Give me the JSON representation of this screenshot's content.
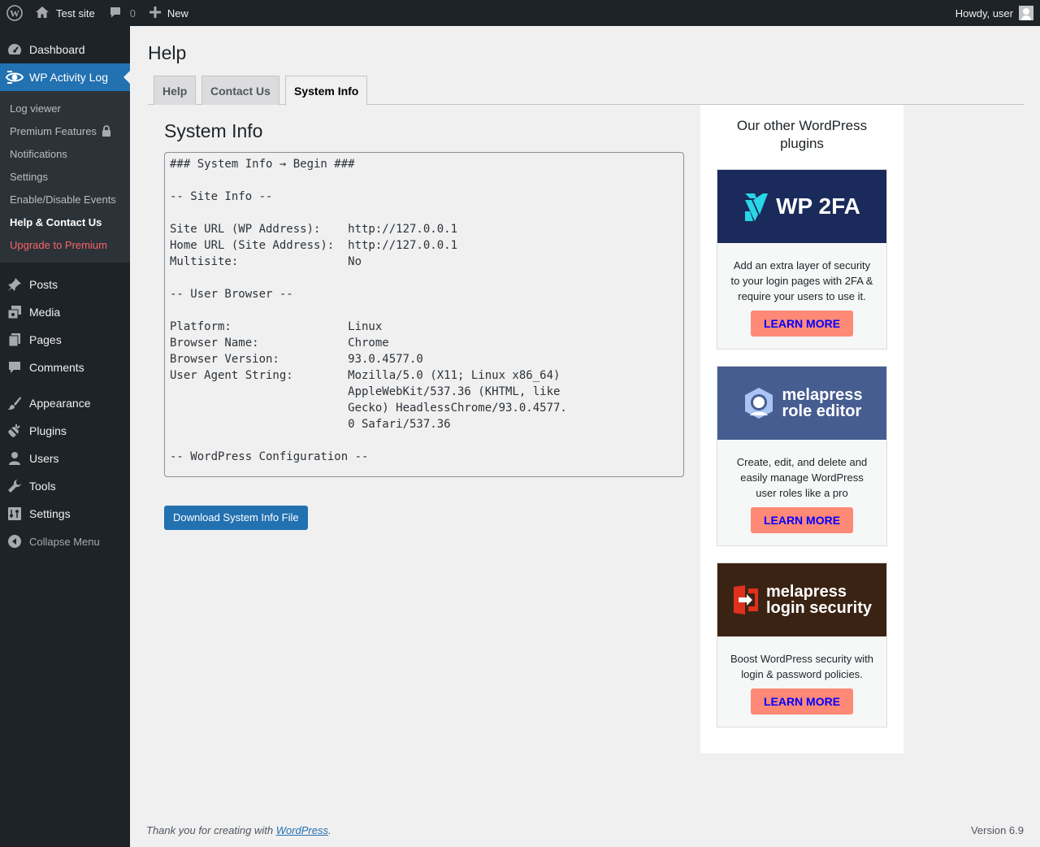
{
  "adminbar": {
    "site_name": "Test site",
    "comments_count": "0",
    "new_label": "New",
    "howdy": "Howdy, user"
  },
  "sidebar": {
    "dashboard": "Dashboard",
    "activity_log": "WP Activity Log",
    "submenu": [
      {
        "label": "Log viewer"
      },
      {
        "label": "Premium Features"
      },
      {
        "label": "Notifications"
      },
      {
        "label": "Settings"
      },
      {
        "label": "Enable/Disable Events"
      },
      {
        "label": "Help & Contact Us"
      },
      {
        "label": "Upgrade to Premium"
      }
    ],
    "items": [
      {
        "label": "Posts",
        "icon": "pushpin-icon"
      },
      {
        "label": "Media",
        "icon": "media-icon"
      },
      {
        "label": "Pages",
        "icon": "pages-icon"
      },
      {
        "label": "Comments",
        "icon": "comments-icon"
      },
      {
        "label": "Appearance",
        "icon": "brush-icon"
      },
      {
        "label": "Plugins",
        "icon": "plugin-icon"
      },
      {
        "label": "Users",
        "icon": "users-icon"
      },
      {
        "label": "Tools",
        "icon": "wrench-icon"
      },
      {
        "label": "Settings",
        "icon": "settings-icon"
      }
    ],
    "collapse": "Collapse Menu"
  },
  "page": {
    "title": "Help",
    "tabs": [
      {
        "label": "Help"
      },
      {
        "label": "Contact Us"
      },
      {
        "label": "System Info"
      }
    ],
    "section_title": "System Info",
    "system_info": "### System Info → Begin ###\n\n-- Site Info --\n\nSite URL (WP Address):    http://127.0.0.1\nHome URL (Site Address):  http://127.0.0.1\nMultisite:                No\n\n-- User Browser --\n\nPlatform:                 Linux\nBrowser Name:             Chrome\nBrowser Version:          93.0.4577.0\nUser Agent String:        Mozilla/5.0 (X11; Linux x86_64)\n                          AppleWebKit/537.36 (KHTML, like\n                          Gecko) HeadlessChrome/93.0.4577.\n                          0 Safari/537.36\n\n-- WordPress Configuration --",
    "download_button": "Download System Info File"
  },
  "promo": {
    "title": "Our other WordPress plugins",
    "cards": [
      {
        "banner_text": "WP 2FA",
        "banner_color": "#1a2a5a",
        "text": "Add an extra layer of security to your login pages with 2FA & require your users to use it.",
        "button": "LEARN MORE"
      },
      {
        "banner_text_1": "melapress",
        "banner_text_2": "role editor",
        "banner_color": "#465d91",
        "text": "Create, edit, and delete and easily manage WordPress user roles like a pro",
        "button": "LEARN MORE"
      },
      {
        "banner_text_1": "melapress",
        "banner_text_2": "login security",
        "banner_color": "#3b2314",
        "text": "Boost WordPress security with login & password policies.",
        "button": "LEARN MORE"
      }
    ]
  },
  "footer": {
    "thanks_prefix": "Thank you for creating with ",
    "wordpress_link": "WordPress",
    "thanks_suffix": ".",
    "version": "Version 6.9"
  }
}
